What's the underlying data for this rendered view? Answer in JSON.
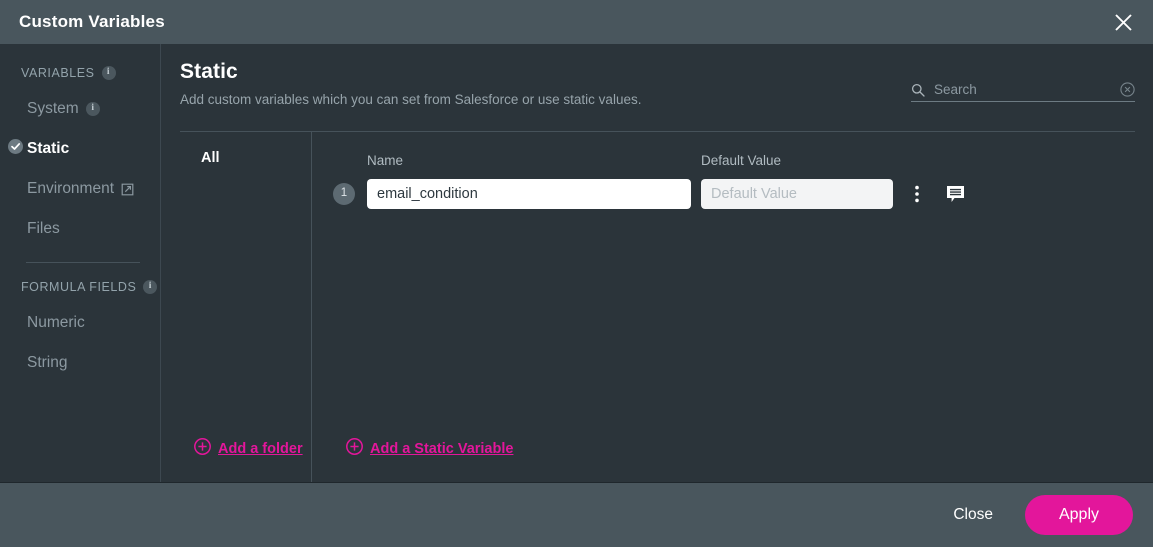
{
  "window": {
    "title": "Custom Variables",
    "close_icon": "close-icon"
  },
  "sidebar": {
    "groups": [
      {
        "label": "VARIABLES",
        "has_info": true,
        "items": [
          {
            "label": "System",
            "has_info": true,
            "selected": false,
            "external": false
          },
          {
            "label": "Static",
            "has_info": false,
            "selected": true,
            "external": false
          },
          {
            "label": "Environment",
            "has_info": false,
            "selected": false,
            "external": true
          },
          {
            "label": "Files",
            "has_info": false,
            "selected": false,
            "external": false
          }
        ]
      },
      {
        "label": "FORMULA FIELDS",
        "has_info": true,
        "items": [
          {
            "label": "Numeric",
            "has_info": false,
            "selected": false,
            "external": false
          },
          {
            "label": "String",
            "has_info": false,
            "selected": false,
            "external": false
          }
        ]
      }
    ]
  },
  "main": {
    "title": "Static",
    "subtitle": "Add custom variables which you can set from Salesforce or use static values.",
    "search": {
      "placeholder": "Search",
      "value": "",
      "icon": "search-icon",
      "clear_icon": "clear-icon"
    },
    "folders": {
      "all_label": "All",
      "add_folder_label": "Add a folder"
    },
    "table": {
      "headers": {
        "number": "",
        "name": "Name",
        "default_value": "Default Value"
      },
      "rows": [
        {
          "number": "1",
          "name_value": "email_condition",
          "name_placeholder": "Name",
          "default_value": "",
          "default_placeholder": "Default Value",
          "menu_icon": "kebab-menu-icon",
          "comment_icon": "comment-icon"
        }
      ],
      "add_variable_label": "Add a Static Variable"
    }
  },
  "footer": {
    "close_label": "Close",
    "apply_label": "Apply"
  },
  "colors": {
    "accent": "#e3169b",
    "titlebar": "#49565d",
    "body": "#2b343a",
    "footer": "#49565d"
  }
}
